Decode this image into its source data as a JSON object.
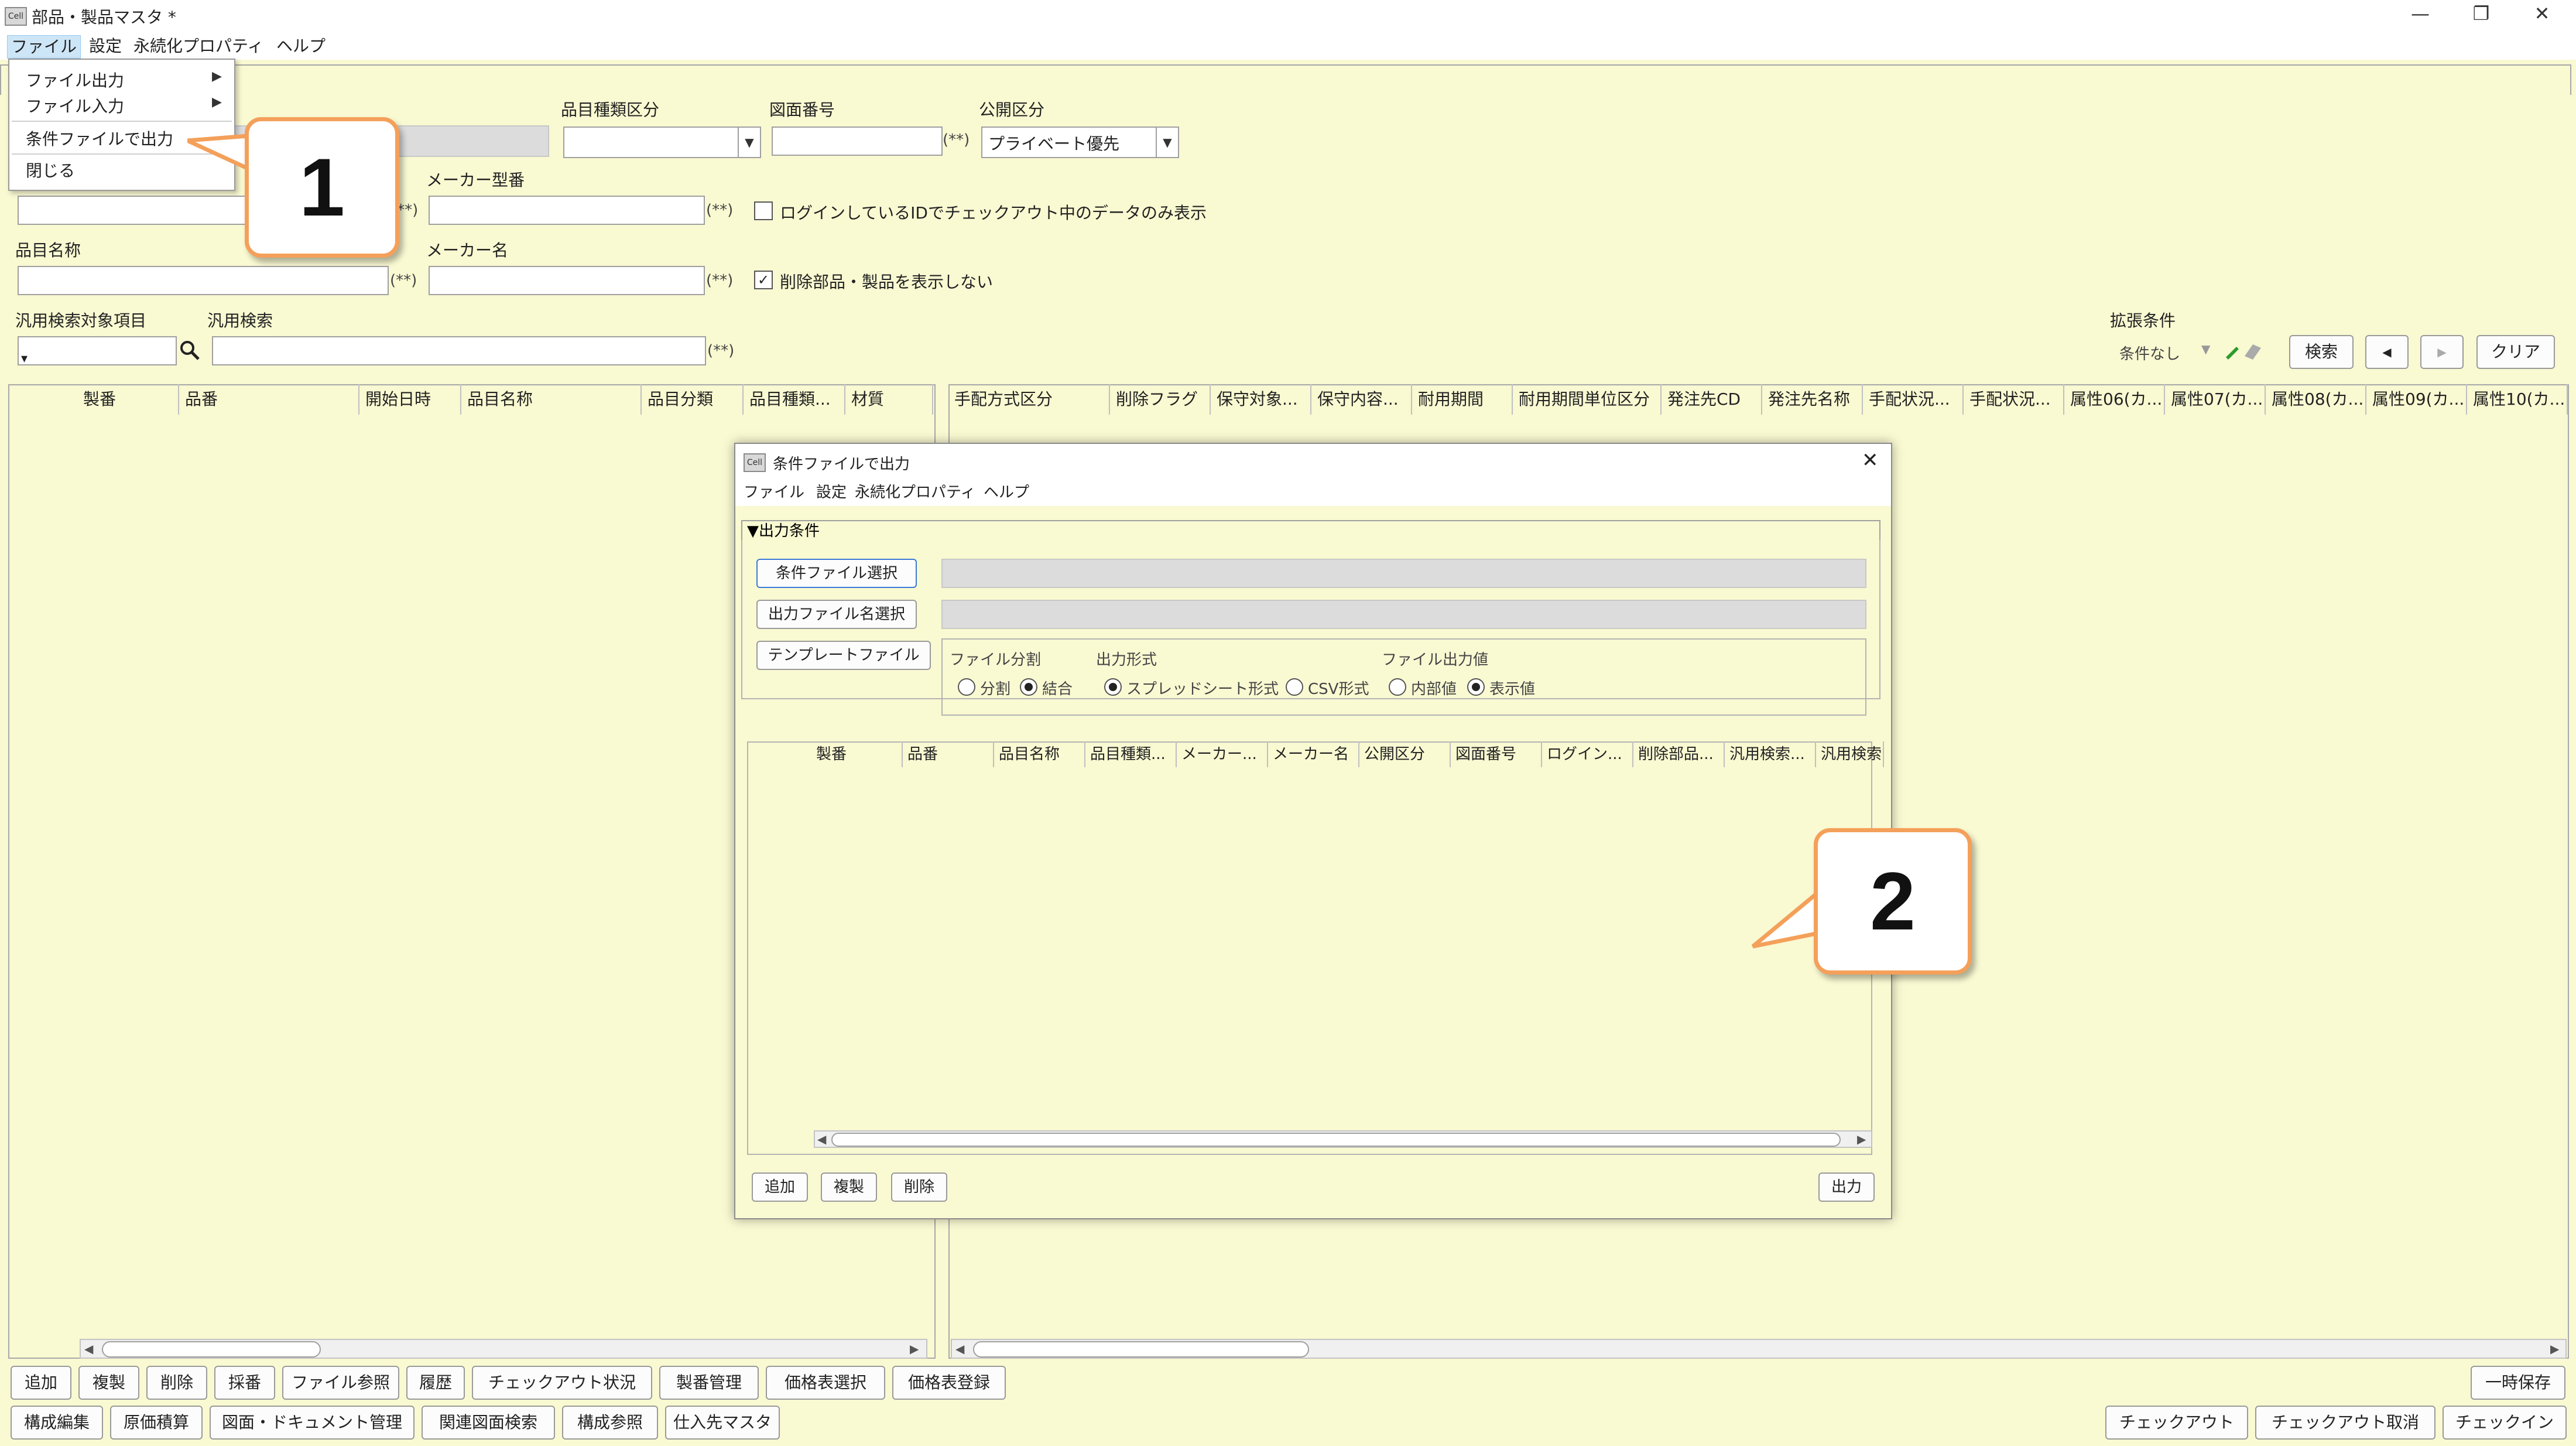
{
  "window": {
    "title": "部品・製品マスタ *",
    "icon_label": "Cell",
    "controls": [
      "—",
      "❐",
      "✕"
    ]
  },
  "menubar": [
    "ファイル",
    "設定",
    "永続化プロパティ",
    "ヘルプ"
  ],
  "file_menu": {
    "items": [
      {
        "label": "ファイル出力",
        "submenu": true
      },
      {
        "label": "ファイル入力",
        "submenu": true
      },
      {
        "label": "条件ファイルで出力",
        "submenu": false
      },
      {
        "label": "閉じる",
        "submenu": false
      }
    ]
  },
  "form": {
    "item_type_label": "品目種類区分",
    "drawing_no_label": "図面番号",
    "public_label": "公開区分",
    "public_value": "プライベート優先",
    "maker_model_label": "メーカー型番",
    "item_name_label": "品目名称",
    "maker_name_label": "メーカー名",
    "required_mark": "(**)",
    "checkout_only_label": "ログインしているIDでチェックアウト中のデータのみ表示",
    "hide_deleted_label": "削除部品・製品を表示しない",
    "general_target_label": "汎用検索対象項目",
    "general_search_label": "汎用検索",
    "ext_condition_label": "拡張条件",
    "ext_condition_value": "条件なし",
    "search_button": "検索",
    "clear_button": "クリア",
    "prev": "◀",
    "next": "▶"
  },
  "left_table": {
    "columns": [
      "製番",
      "品番",
      "開始日時",
      "品目名称",
      "品目分類",
      "品目種類...",
      "材質"
    ]
  },
  "right_table": {
    "columns": [
      "手配方式区分",
      "削除フラグ",
      "保守対象...",
      "保守内容...",
      "耐用期間",
      "耐用期間単位区分",
      "発注先CD",
      "発注先名称",
      "手配状況...",
      "手配状況...",
      "属性06(カ...",
      "属性07(カ...",
      "属性08(カ...",
      "属性09(カ...",
      "属性10(カ..."
    ]
  },
  "bottom_buttons_row1": [
    "追加",
    "複製",
    "削除",
    "採番",
    "ファイル参照",
    "履歴",
    "チェックアウト状況",
    "製番管理",
    "価格表選択",
    "価格表登録"
  ],
  "bottom_buttons_row2": [
    "構成編集",
    "原価積算",
    "図面・ドキュメント管理",
    "関連図面検索",
    "構成参照",
    "仕入先マスタ"
  ],
  "temp_save": "一時保存",
  "right_buttons": [
    "チェックアウト",
    "チェックアウト取消",
    "チェックイン"
  ],
  "callouts": [
    "1",
    "2"
  ],
  "dialog": {
    "title": "条件ファイルで出力",
    "icon_label": "Cell",
    "menubar": [
      "ファイル",
      "設定",
      "永続化プロパティ",
      "ヘルプ"
    ],
    "section": "▼出力条件",
    "cond_file_button": "条件ファイル選択",
    "out_file_button": "出力ファイル名選択",
    "template_button": "テンプレートファイル",
    "file_split_label": "ファイル分割",
    "split_options": [
      "分割",
      "結合"
    ],
    "output_format_label": "出力形式",
    "format_options": [
      "スプレッドシート形式",
      "CSV形式"
    ],
    "output_value_label": "ファイル出力値",
    "value_options": [
      "内部値",
      "表示値"
    ],
    "columns": [
      "製番",
      "品番",
      "品目名称",
      "品目種類...",
      "メーカー...",
      "メーカー名",
      "公開区分",
      "図面番号",
      "ログイン...",
      "削除部品...",
      "汎用検索...",
      "汎用検索"
    ],
    "add_button": "追加",
    "copy_button": "複製",
    "delete_button": "削除",
    "output_button": "出力"
  }
}
